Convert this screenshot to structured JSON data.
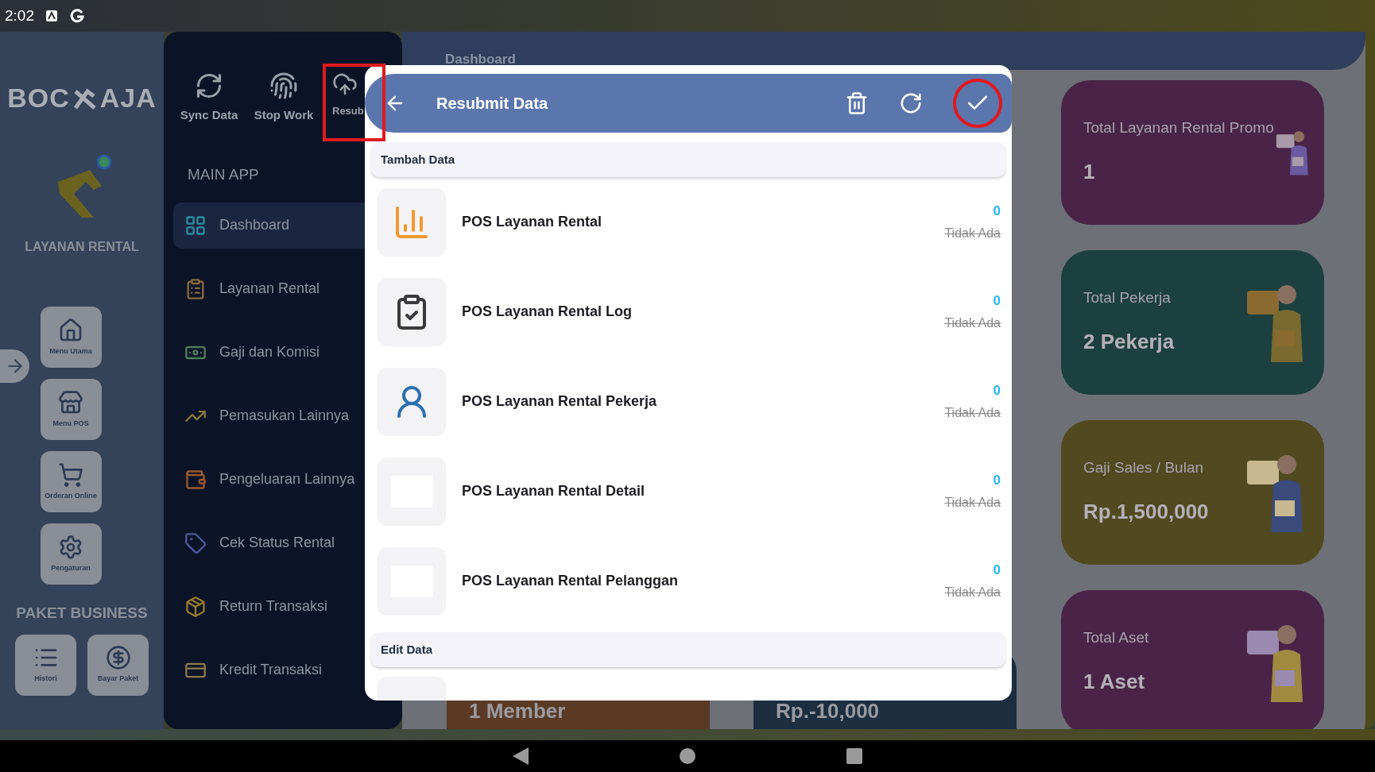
{
  "status_bar": {
    "time": "2:02"
  },
  "logo": {
    "left": "BOC",
    "right": "AJA"
  },
  "app": {
    "name": "LAYANAN RENTAL"
  },
  "rail_buttons": [
    {
      "label": "Menu Utama"
    },
    {
      "label": "Menu POS"
    },
    {
      "label": "Orderan Online"
    },
    {
      "label": "Pengaturan"
    }
  ],
  "package": {
    "title": "PAKET BUSINESS",
    "buttons": [
      {
        "label": "Histori"
      },
      {
        "label": "Bayar Paket"
      }
    ]
  },
  "toolbar": [
    {
      "label": "Sync Data",
      "highlighted": false
    },
    {
      "label": "Stop Work",
      "highlighted": false
    },
    {
      "label": "Resub",
      "highlighted": true
    }
  ],
  "menu": {
    "title": "MAIN APP",
    "items": [
      {
        "label": "Dashboard",
        "selected": true
      },
      {
        "label": "Layanan Rental",
        "selected": false
      },
      {
        "label": "Gaji dan Komisi",
        "selected": false
      },
      {
        "label": "Pemasukan Lainnya",
        "selected": false
      },
      {
        "label": "Pengeluaran Lainnya",
        "selected": false
      },
      {
        "label": "Cek Status Rental",
        "selected": false
      },
      {
        "label": "Return Transaksi",
        "selected": false
      },
      {
        "label": "Kredit Transaksi",
        "selected": false
      }
    ]
  },
  "header": {
    "title": "Dashboard"
  },
  "cards": [
    {
      "title": "Total Layanan Rental Promo",
      "value": "1",
      "color": "#4a2448"
    },
    {
      "title": "Total Pekerja",
      "value": "2 Pekerja",
      "color": "#1b403f"
    },
    {
      "title": "Gaji Sales / Bulan",
      "value": "Rp.1,500,000",
      "color": "#514a20"
    },
    {
      "title": "Total Aset",
      "value": "1 Aset",
      "color": "#4a2448"
    }
  ],
  "bottom_cards": [
    {
      "value": "1 Member",
      "color": "#5b3a25"
    },
    {
      "value": "Rp.-10,000",
      "color": "#1c2e40"
    }
  ],
  "dialog": {
    "title": "Resubmit Data",
    "confirm_highlighted": true,
    "sections": [
      {
        "title": "Tambah Data",
        "rows": [
          {
            "name": "POS Layanan Rental",
            "count": "0",
            "status": "Tidak Ada",
            "struck": true
          },
          {
            "name": "POS Layanan Rental Log",
            "count": "0",
            "status": "Tidak Ada",
            "struck": true
          },
          {
            "name": "POS Layanan Rental Pekerja",
            "count": "0",
            "status": "Tidak Ada",
            "struck": true
          },
          {
            "name": "POS Layanan Rental Detail",
            "count": "0",
            "status": "Tidak Ada",
            "struck": true
          },
          {
            "name": "POS Layanan Rental Pelanggan",
            "count": "0",
            "status": "Tidak Ada",
            "struck": true
          }
        ]
      },
      {
        "title": "Edit Data"
      }
    ]
  }
}
